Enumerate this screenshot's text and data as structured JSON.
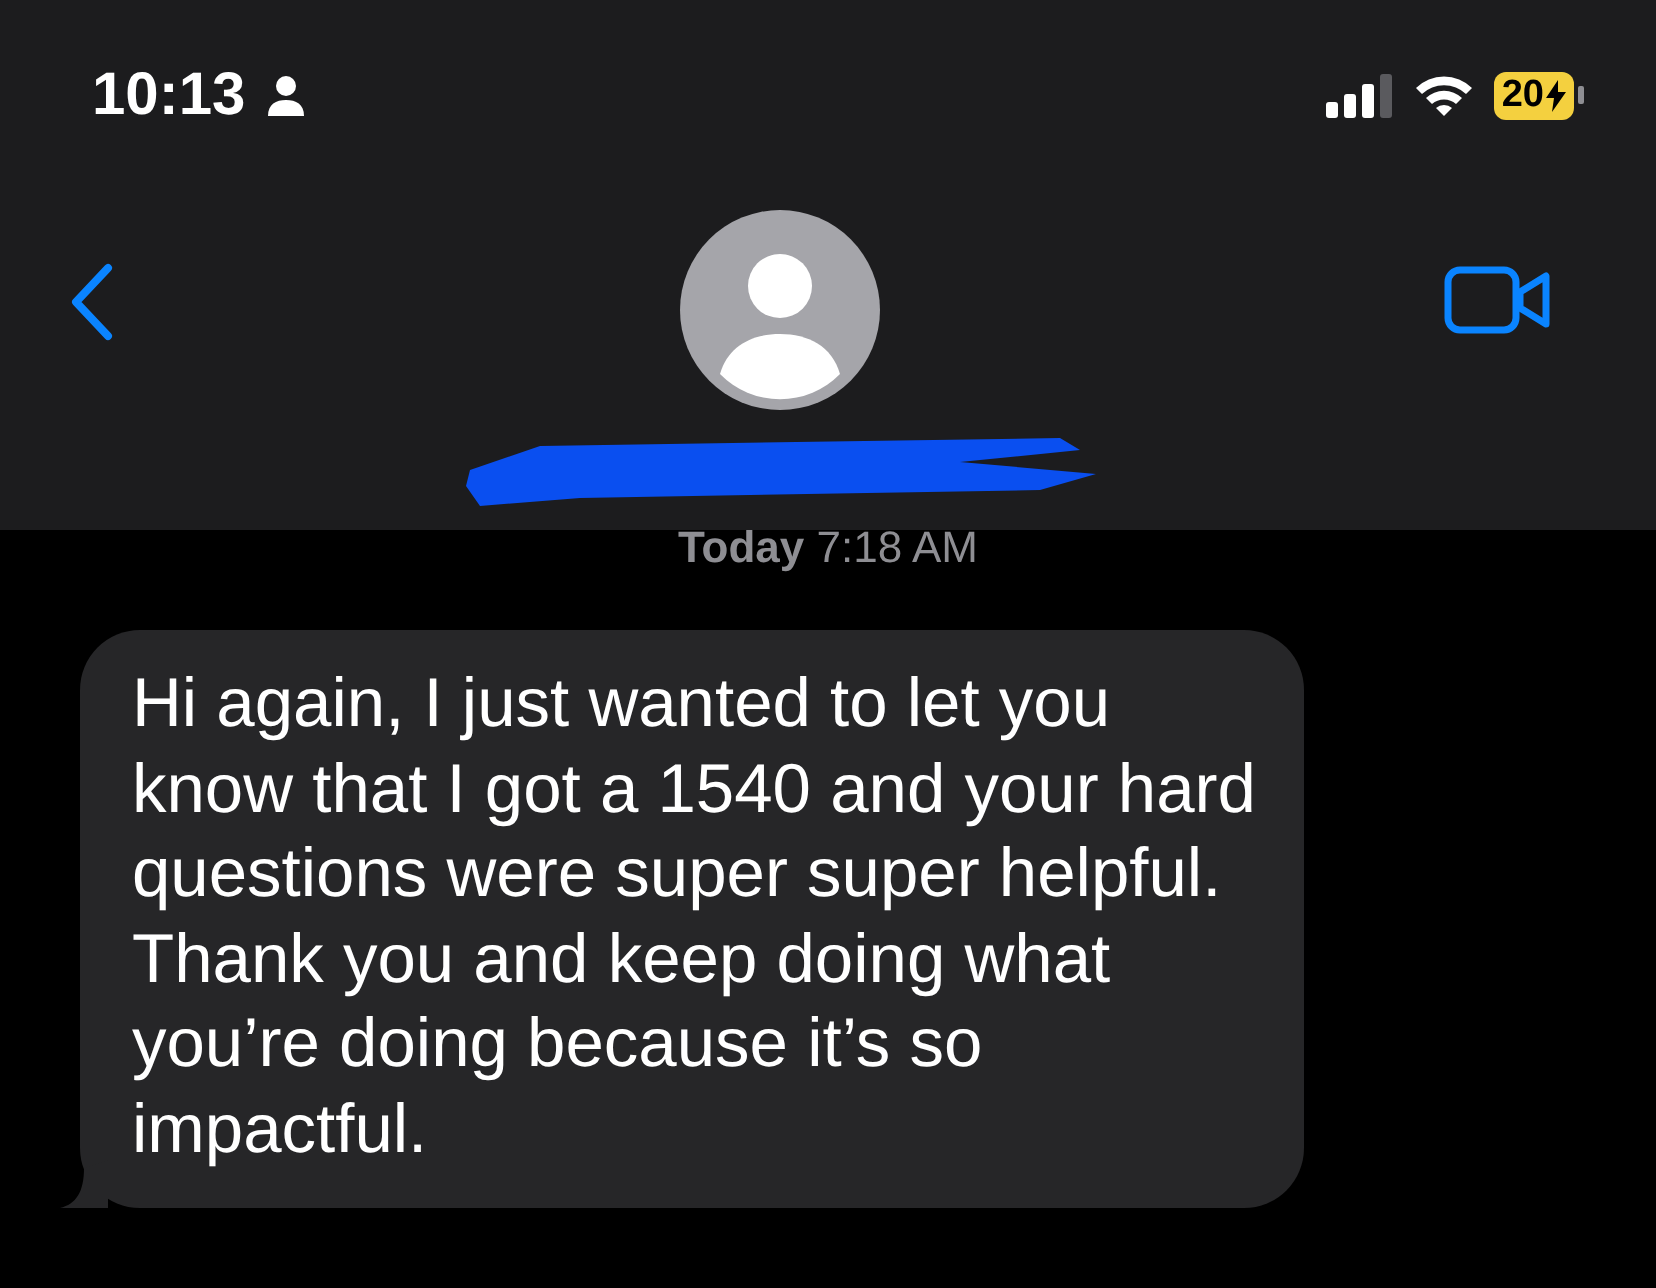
{
  "status_bar": {
    "time": "10:13",
    "battery": "20",
    "low_power": true
  },
  "conversation": {
    "timestamp_day": "Today",
    "timestamp_time": "7:18 AM"
  },
  "messages": [
    {
      "text": "Hi again, I just wanted to let you know that I got a 1540 and your hard questions were super super helpful. Thank you and keep doing what you’re doing because it’s so impactful.",
      "incoming": true
    }
  ]
}
